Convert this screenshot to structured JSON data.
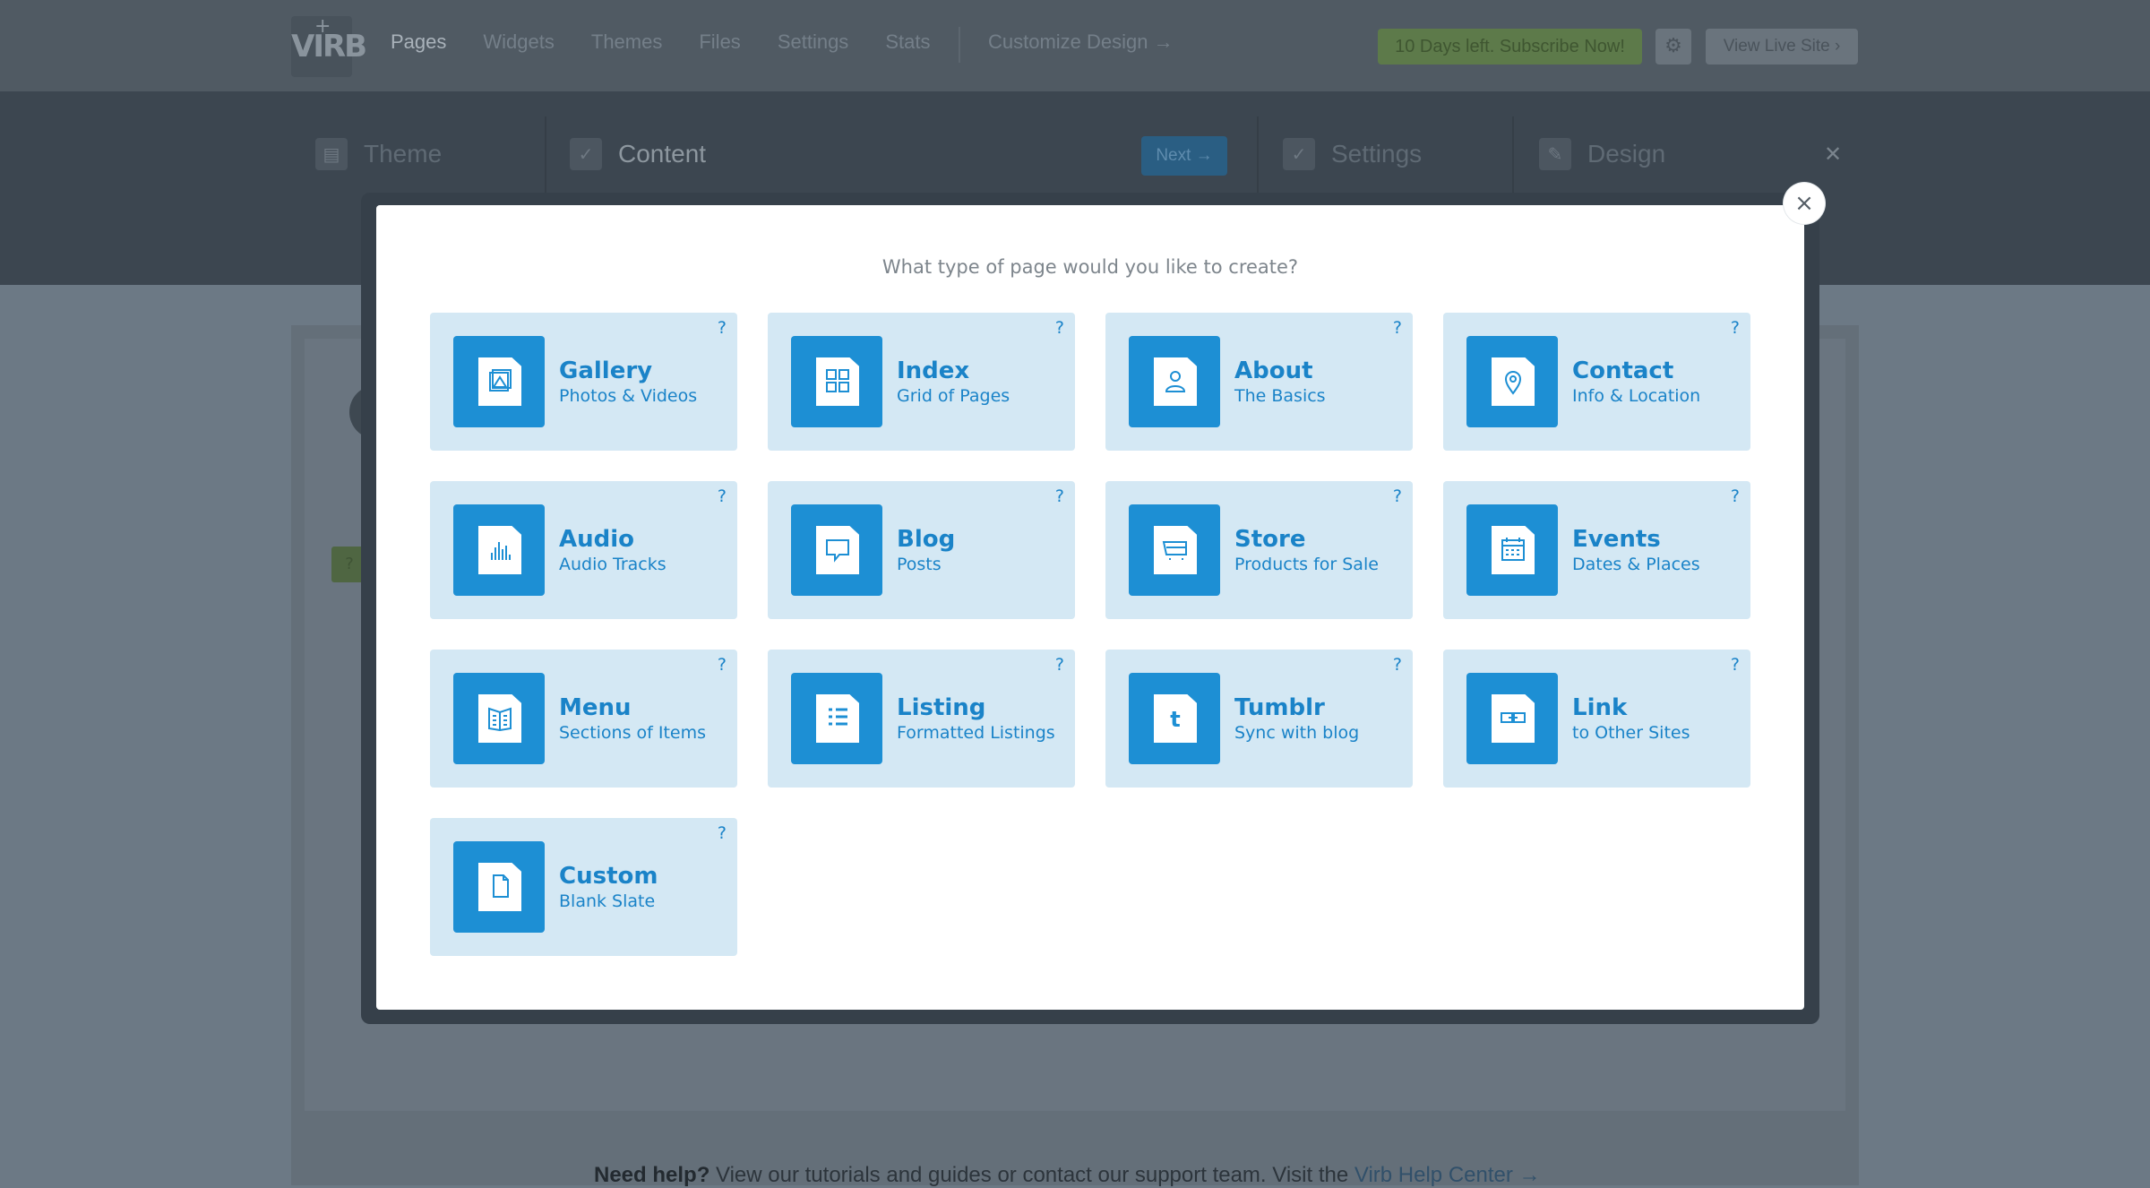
{
  "app": {
    "logo": "VIRB",
    "nav": [
      "Pages",
      "Widgets",
      "Themes",
      "Files",
      "Settings",
      "Stats"
    ],
    "active_nav": "Pages",
    "customize": "Customize Design →",
    "subscribe": "10 Days left. Subscribe Now!",
    "view_live": "View Live Site ›"
  },
  "steps": [
    {
      "label": "Theme",
      "icon": "layout-icon"
    },
    {
      "label": "Content",
      "icon": "check-icon"
    },
    {
      "label": "Settings",
      "icon": "check-icon"
    },
    {
      "label": "Design",
      "icon": "brush-icon"
    }
  ],
  "next_button": "Next →",
  "help": {
    "bold": "Need help?",
    "text": " View our tutorials and guides or contact our support team. Visit the ",
    "link": "Virb Help Center →"
  },
  "modal": {
    "title": "What type of page would you like to create?",
    "close": "×",
    "cards": [
      {
        "name": "Gallery",
        "sub": "Photos & Videos",
        "icon": "gallery-icon",
        "q": "?"
      },
      {
        "name": "Index",
        "sub": "Grid of Pages",
        "icon": "grid-icon",
        "q": "?"
      },
      {
        "name": "About",
        "sub": "The Basics",
        "icon": "person-icon",
        "q": "?"
      },
      {
        "name": "Contact",
        "sub": "Info & Location",
        "icon": "location-pin-icon",
        "q": "?"
      },
      {
        "name": "Audio",
        "sub": "Audio Tracks",
        "icon": "audio-bars-icon",
        "q": "?"
      },
      {
        "name": "Blog",
        "sub": "Posts",
        "icon": "speech-bubble-icon",
        "q": "?"
      },
      {
        "name": "Store",
        "sub": "Products for Sale",
        "icon": "cart-icon",
        "q": "?"
      },
      {
        "name": "Events",
        "sub": "Dates & Places",
        "icon": "calendar-icon",
        "q": "?"
      },
      {
        "name": "Menu",
        "sub": "Sections of Items",
        "icon": "menu-book-icon",
        "q": "?"
      },
      {
        "name": "Listing",
        "sub": "Formatted Listings",
        "icon": "list-icon",
        "q": "?"
      },
      {
        "name": "Tumblr",
        "sub": "Sync with blog",
        "icon": "tumblr-icon",
        "q": "?"
      },
      {
        "name": "Link",
        "sub": "to Other Sites",
        "icon": "link-icon",
        "q": "?"
      },
      {
        "name": "Custom",
        "sub": "Blank Slate",
        "icon": "blank-doc-icon",
        "q": "?"
      }
    ]
  },
  "colors": {
    "accent": "#1d8fd4",
    "card_bg": "#d4e8f4",
    "card_text": "#1a83c8"
  }
}
